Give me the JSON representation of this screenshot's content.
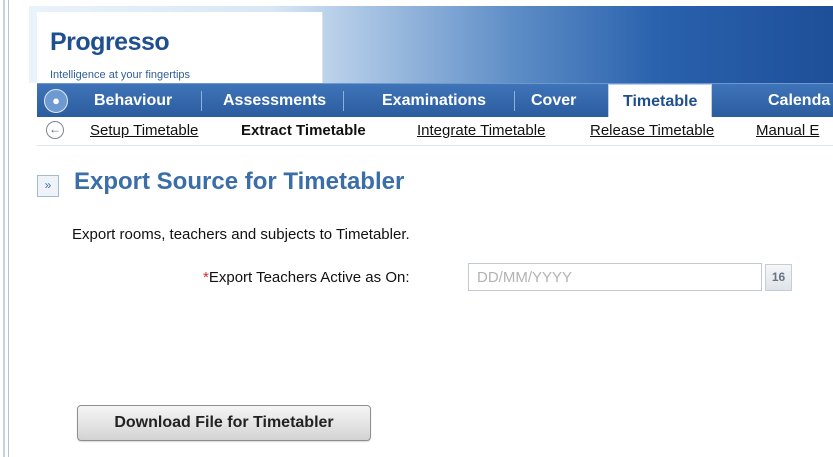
{
  "app": {
    "logo": "Progresso",
    "tagline": "Intelligence at your fingertips"
  },
  "nav": {
    "tabs": [
      {
        "label": "Behaviour",
        "active": false
      },
      {
        "label": "Assessments",
        "active": false
      },
      {
        "label": "Examinations",
        "active": false
      },
      {
        "label": "Cover",
        "active": false
      },
      {
        "label": "Timetable",
        "active": true
      },
      {
        "label": "Calenda",
        "active": false
      }
    ]
  },
  "subnav": {
    "items": [
      {
        "label": "Setup Timetable",
        "active": false
      },
      {
        "label": "Extract Timetable",
        "active": true
      },
      {
        "label": "Integrate Timetable",
        "active": false
      },
      {
        "label": "Release Timetable",
        "active": false
      },
      {
        "label": "Manual E",
        "active": false
      }
    ]
  },
  "page": {
    "title": "Export Source for Timetabler",
    "intro": "Export rooms, teachers and subjects to Timetabler."
  },
  "form": {
    "required_marker": "*",
    "teachers_date_label": "Export Teachers Active as On:",
    "teachers_date_value": "",
    "teachers_date_placeholder": "DD/MM/YYYY",
    "calendar_icon_text": "16"
  },
  "actions": {
    "download_label": "Download File for Timetabler"
  },
  "colors": {
    "brand_blue": "#2b5c9f",
    "title_blue": "#3b6ea8",
    "required_red": "#d42a2a"
  },
  "icons": {
    "home": "home-icon",
    "back": "back-arrow-icon",
    "collapse": "collapse-panel-icon",
    "calendar": "calendar-icon"
  }
}
